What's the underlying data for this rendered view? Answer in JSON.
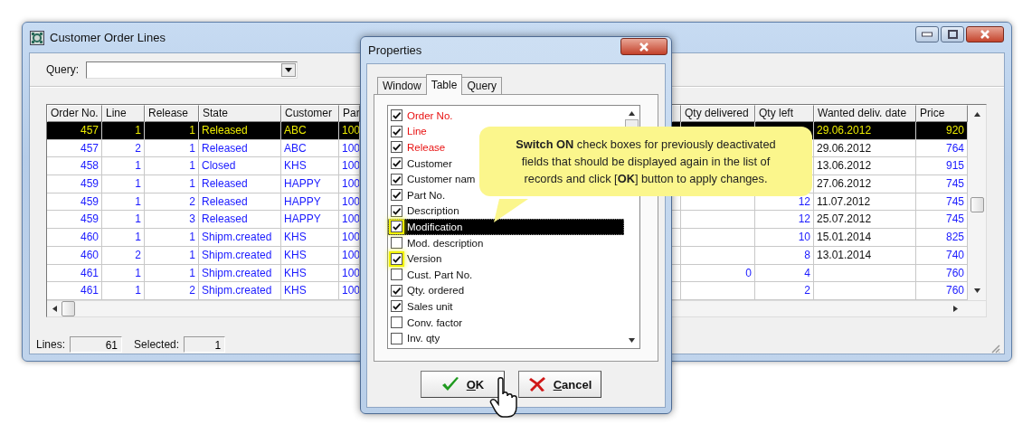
{
  "window": {
    "title": "Customer Order Lines"
  },
  "query": {
    "label": "Query:"
  },
  "table": {
    "columns_left": [
      "Order No.",
      "Line",
      "Release",
      "State",
      "Customer",
      "Par"
    ],
    "columns_right": [
      "Qty delivered",
      "Qty left",
      "Wanted deliv. date",
      "Price"
    ],
    "rows": [
      {
        "selected": true,
        "order_no": "457",
        "line": "1",
        "release": "1",
        "state": "Released",
        "customer": "ABC",
        "part": "100",
        "date": "29.06.2012",
        "price": "920"
      },
      {
        "selected": false,
        "order_no": "457",
        "line": "2",
        "release": "1",
        "state": "Released",
        "customer": "ABC",
        "part": "100",
        "date": "29.06.2012",
        "price": "764"
      },
      {
        "selected": false,
        "order_no": "458",
        "line": "1",
        "release": "1",
        "state": "Closed",
        "customer": "KHS",
        "part": "100",
        "date": "13.06.2012",
        "price": "915"
      },
      {
        "selected": false,
        "order_no": "459",
        "line": "1",
        "release": "1",
        "state": "Released",
        "customer": "HAPPY",
        "part": "100",
        "date": "27.06.2012",
        "price": "745"
      },
      {
        "selected": false,
        "order_no": "459",
        "line": "1",
        "release": "2",
        "state": "Released",
        "customer": "HAPPY",
        "part": "100",
        "qty_left": "12",
        "date": "11.07.2012",
        "price": "745"
      },
      {
        "selected": false,
        "order_no": "459",
        "line": "1",
        "release": "3",
        "state": "Released",
        "customer": "HAPPY",
        "part": "100",
        "qty_left": "12",
        "date": "25.07.2012",
        "price": "745"
      },
      {
        "selected": false,
        "order_no": "460",
        "line": "1",
        "release": "1",
        "state": "Shipm.created",
        "customer": "KHS",
        "part": "100",
        "qty_left": "10",
        "date": "15.01.2014",
        "price": "825"
      },
      {
        "selected": false,
        "order_no": "460",
        "line": "2",
        "release": "1",
        "state": "Shipm.created",
        "customer": "KHS",
        "part": "100",
        "qty_left": "8",
        "date": "13.01.2014",
        "price": "740"
      },
      {
        "selected": false,
        "order_no": "461",
        "line": "1",
        "release": "1",
        "state": "Shipm.created",
        "customer": "KHS",
        "part": "100",
        "qty_delivered": "0",
        "qty_left": "4",
        "price": "760"
      },
      {
        "selected": false,
        "order_no": "461",
        "line": "1",
        "release": "2",
        "state": "Shipm.created",
        "customer": "KHS",
        "part": "100",
        "qty_left": "2",
        "price": "760"
      }
    ]
  },
  "status_bar": {
    "lines_label": "Lines:",
    "lines_value": "61",
    "selected_label": "Selected:",
    "selected_value": "1"
  },
  "dialog": {
    "title": "Properties",
    "tabs": [
      {
        "label": "Window",
        "selected": false
      },
      {
        "label": "Table",
        "selected": true
      },
      {
        "label": "Query",
        "selected": false
      }
    ],
    "fields": [
      {
        "label": "Order No.",
        "checked": true,
        "mandatory": true,
        "selected": false,
        "highlighted": false
      },
      {
        "label": "Line",
        "checked": true,
        "mandatory": true,
        "selected": false,
        "highlighted": false
      },
      {
        "label": "Release",
        "checked": true,
        "mandatory": true,
        "selected": false,
        "highlighted": false
      },
      {
        "label": "Customer",
        "checked": true,
        "mandatory": false,
        "selected": false,
        "highlighted": false
      },
      {
        "label": "Customer nam",
        "checked": true,
        "mandatory": false,
        "selected": false,
        "highlighted": false
      },
      {
        "label": "Part No.",
        "checked": true,
        "mandatory": false,
        "selected": false,
        "highlighted": false
      },
      {
        "label": "Description",
        "checked": true,
        "mandatory": false,
        "selected": false,
        "highlighted": false
      },
      {
        "label": "Modification",
        "checked": true,
        "mandatory": false,
        "selected": true,
        "highlighted": true
      },
      {
        "label": "Mod. description",
        "checked": false,
        "mandatory": false,
        "selected": false,
        "highlighted": false
      },
      {
        "label": "Version",
        "checked": true,
        "mandatory": false,
        "selected": false,
        "highlighted": true
      },
      {
        "label": "Cust. Part No.",
        "checked": false,
        "mandatory": false,
        "selected": false,
        "highlighted": false
      },
      {
        "label": "Qty. ordered",
        "checked": true,
        "mandatory": false,
        "selected": false,
        "highlighted": false
      },
      {
        "label": "Sales unit",
        "checked": true,
        "mandatory": false,
        "selected": false,
        "highlighted": false
      },
      {
        "label": "Conv. factor",
        "checked": false,
        "mandatory": false,
        "selected": false,
        "highlighted": false
      },
      {
        "label": "Inv. qty",
        "checked": false,
        "mandatory": false,
        "selected": false,
        "highlighted": false
      }
    ],
    "buttons": [
      {
        "label": "OK",
        "kind": "ok"
      },
      {
        "label": "Cancel",
        "kind": "cancel"
      }
    ]
  },
  "callout": {
    "text": "**Switch ON** check boxes for previously deactivated fields that should be displayed again in the list of records and click [**OK**] button to apply changes."
  }
}
